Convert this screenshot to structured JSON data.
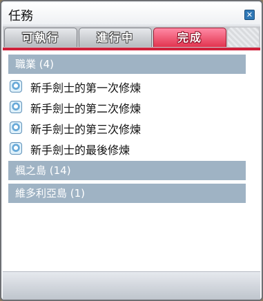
{
  "window": {
    "title": "任務"
  },
  "tabs": [
    {
      "label": "可執行",
      "active": false
    },
    {
      "label": "進行中",
      "active": false
    },
    {
      "label": "完成",
      "active": true
    }
  ],
  "categories": [
    {
      "label": "職業 (4)",
      "expanded": true,
      "quests": [
        {
          "title": "新手劍士的第一次修煉"
        },
        {
          "title": "新手劍士的第二次修煉"
        },
        {
          "title": "新手劍士的第三次修煉"
        },
        {
          "title": "新手劍士的最後修煉"
        }
      ]
    },
    {
      "label": "楓之島 (14)",
      "expanded": false
    },
    {
      "label": "維多利亞島 (1)",
      "expanded": false
    }
  ],
  "colors": {
    "active_tab": "#e2344f",
    "category_header": "#9fb3c4",
    "accent_line": "#d0213b"
  },
  "icons": {
    "close": "close-icon",
    "quest": "quest-scroll-icon"
  }
}
